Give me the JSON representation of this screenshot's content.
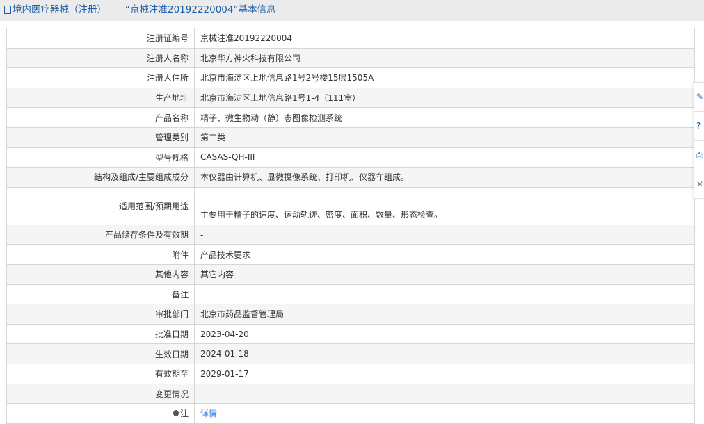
{
  "title": "境内医疗器械（注册）——“京械注准20192220004”基本信息",
  "rows": [
    {
      "label": "注册证编号",
      "value": "京械注准20192220004"
    },
    {
      "label": "注册人名称",
      "value": "北京华方神火科技有限公司"
    },
    {
      "label": "注册人住所",
      "value": "北京市海淀区上地信息路1号2号楼15层1505A"
    },
    {
      "label": "生产地址",
      "value": "北京市海淀区上地信息路1号1-4（111室）"
    },
    {
      "label": "产品名称",
      "value": "精子、微生物动（静）态图像检测系统"
    },
    {
      "label": "管理类别",
      "value": "第二类"
    },
    {
      "label": "型号规格",
      "value": "CASAS-QH-III"
    },
    {
      "label": "结构及组成/主要组成成分",
      "value": "本仪器由计算机、显微摄像系统、打印机、仪器车组成。"
    },
    {
      "label": "适用范围/预期用途",
      "value": "主要用于精子的速度、运动轨迹、密度、面积、数量、形态检查。"
    },
    {
      "label": "产品储存条件及有效期",
      "value": "-"
    },
    {
      "label": "附件",
      "value": "产品技术要求"
    },
    {
      "label": "其他内容",
      "value": "其它内容"
    },
    {
      "label": "备注",
      "value": ""
    },
    {
      "label": "审批部门",
      "value": "北京市药品监督管理局"
    },
    {
      "label": "批准日期",
      "value": "2023-04-20"
    },
    {
      "label": "生效日期",
      "value": "2024-01-18"
    },
    {
      "label": "有效期至",
      "value": "2029-01-17"
    },
    {
      "label": "变更情况",
      "value": ""
    }
  ],
  "note": {
    "label": "注",
    "link": "详情"
  }
}
